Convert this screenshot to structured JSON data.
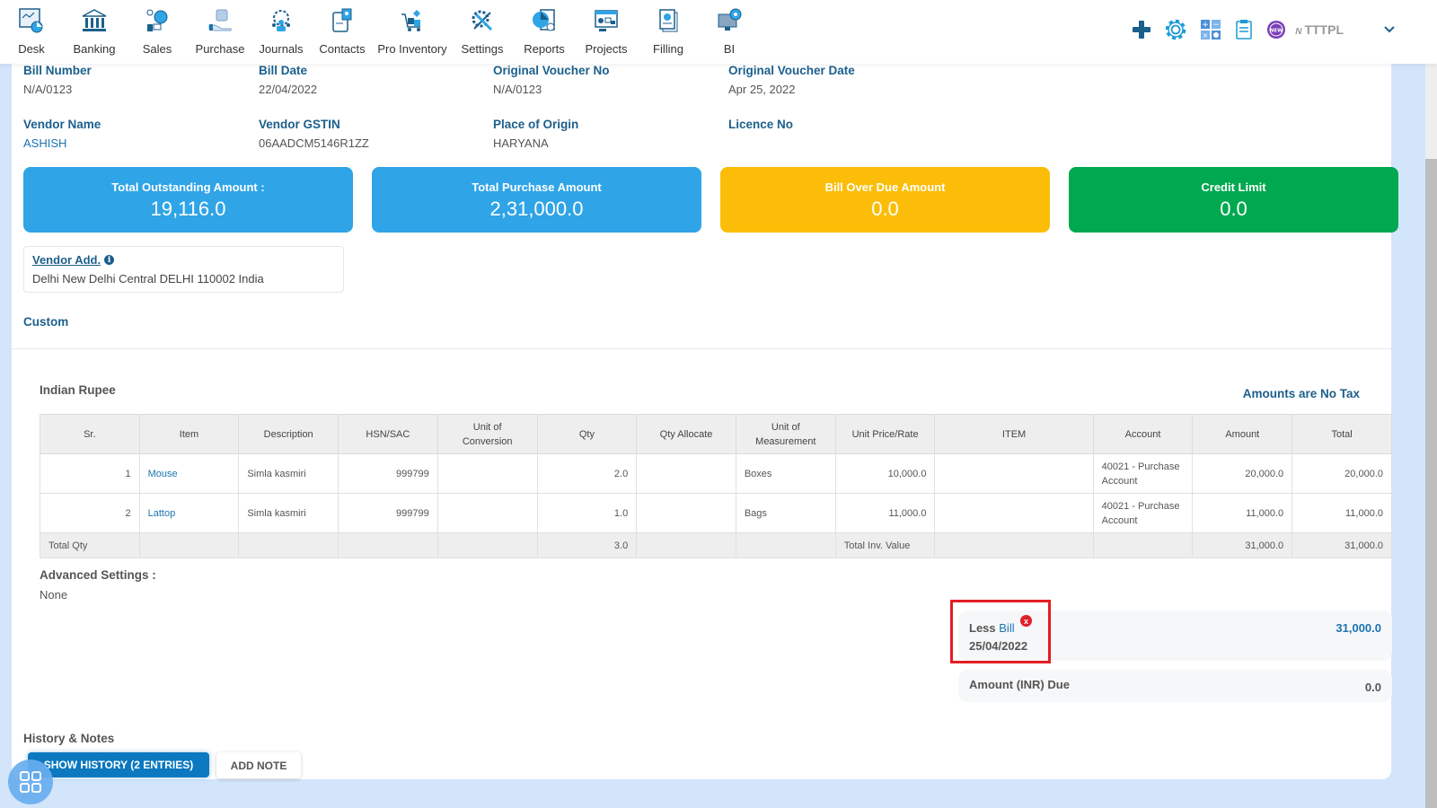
{
  "nav": {
    "items": [
      {
        "label": "Desk",
        "icon": "desk-icon"
      },
      {
        "label": "Banking",
        "icon": "bank-icon"
      },
      {
        "label": "Sales",
        "icon": "sales-icon"
      },
      {
        "label": "Purchase",
        "icon": "purchase-icon"
      },
      {
        "label": "Journals",
        "icon": "journals-icon"
      },
      {
        "label": "Contacts",
        "icon": "contacts-icon"
      },
      {
        "label": "Pro Inventory",
        "icon": "inventory-icon"
      },
      {
        "label": "Settings",
        "icon": "settings-icon"
      },
      {
        "label": "Reports",
        "icon": "reports-icon"
      },
      {
        "label": "Projects",
        "icon": "projects-icon"
      },
      {
        "label": "Filling",
        "icon": "filling-icon"
      },
      {
        "label": "BI",
        "icon": "bi-icon"
      }
    ],
    "right": {
      "org_prefix": "N",
      "org_name": "TTTPL",
      "new_badge": "NEW"
    }
  },
  "bill": {
    "fields_row1": [
      {
        "label": "Bill Number",
        "value": "N/A/0123"
      },
      {
        "label": "Bill Date",
        "value": "22/04/2022"
      },
      {
        "label": "Original Voucher No",
        "value": "N/A/0123"
      },
      {
        "label": "Original Voucher Date",
        "value": "Apr 25, 2022"
      }
    ],
    "fields_row2": [
      {
        "label": "Vendor Name",
        "value": "ASHISH"
      },
      {
        "label": "Vendor GSTIN",
        "value": "06AADCM5146R1ZZ"
      },
      {
        "label": "Place of Origin",
        "value": "HARYANA"
      },
      {
        "label": "Licence No",
        "value": ""
      }
    ]
  },
  "stats": [
    {
      "title": "Total Outstanding Amount :",
      "value": "19,116.0",
      "color": "#2fa4e7"
    },
    {
      "title": "Total Purchase Amount",
      "value": "2,31,000.0",
      "color": "#2fa4e7"
    },
    {
      "title": "Bill Over Due Amount",
      "value": "0.0",
      "color": "#fbbd08"
    },
    {
      "title": "Credit Limit",
      "value": "0.0",
      "color": "#00a84f"
    }
  ],
  "vendor_address": {
    "label": "Vendor Add.",
    "text": "Delhi New Delhi Central DELHI 110002 India"
  },
  "custom_label": "Custom",
  "currency": "Indian Rupee",
  "tax_note": "Amounts are No Tax",
  "table": {
    "headers": [
      "Sr.",
      "Item",
      "Description",
      "HSN/SAC",
      "Unit of Conversion",
      "Qty",
      "Qty Allocate",
      "Unit of Measurement",
      "Unit Price/Rate",
      "ITEM",
      "Account",
      "Amount",
      "Total"
    ],
    "rows": [
      {
        "sr": "1",
        "item": "Mouse",
        "description": "Simla kasmiri",
        "hsn": "999799",
        "conversion": "",
        "qty": "2.0",
        "qty_allocate": "",
        "uom": "Boxes",
        "rate": "10,000.0",
        "item2": "",
        "account": "40021 - Purchase Account",
        "amount": "20,000.0",
        "total": "20,000.0"
      },
      {
        "sr": "2",
        "item": "Lattop",
        "description": "Simla kasmiri",
        "hsn": "999799",
        "conversion": "",
        "qty": "1.0",
        "qty_allocate": "",
        "uom": "Bags",
        "rate": "11,000.0",
        "item2": "",
        "account": "40021 - Purchase Account",
        "amount": "11,000.0",
        "total": "11,000.0"
      }
    ],
    "footer": {
      "total_qty_label": "Total Qty",
      "total_qty": "3.0",
      "total_inv_label": "Total Inv. Value",
      "amount": "31,000.0",
      "total": "31,000.0"
    }
  },
  "advanced": {
    "label": "Advanced Settings :",
    "value": "None"
  },
  "less_bill": {
    "prefix": "Less",
    "link": "Bill",
    "date": "25/04/2022",
    "amount": "31,000.0",
    "remove": "x"
  },
  "due": {
    "label": "Amount (INR) Due",
    "amount": "0.0"
  },
  "history": {
    "title": "History & Notes",
    "show_history": "SHOW HISTORY (2 ENTRIES)",
    "add_note": "ADD NOTE"
  }
}
